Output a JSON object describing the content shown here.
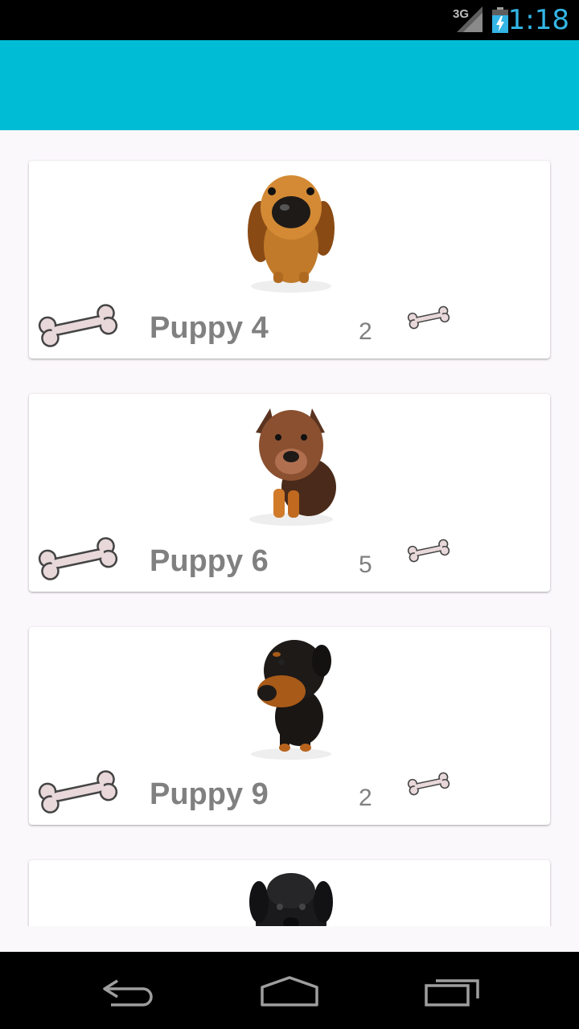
{
  "status_bar": {
    "network": "3G",
    "time": "1:18",
    "icons": [
      "signal-icon",
      "battery-charging-icon"
    ]
  },
  "app_bar": {
    "color": "#00bcd4"
  },
  "puppies": [
    {
      "name": "Puppy 4",
      "count": "2",
      "photo": "dachshund-puppy"
    },
    {
      "name": "Puppy 6",
      "count": "5",
      "photo": "shepherd-puppy"
    },
    {
      "name": "Puppy 9",
      "count": "2",
      "photo": "rottweiler-puppy"
    },
    {
      "name": "",
      "count": "",
      "photo": "black-puppy"
    }
  ],
  "nav_bar": {
    "icons": [
      "back-icon",
      "home-icon",
      "recent-apps-icon"
    ]
  }
}
